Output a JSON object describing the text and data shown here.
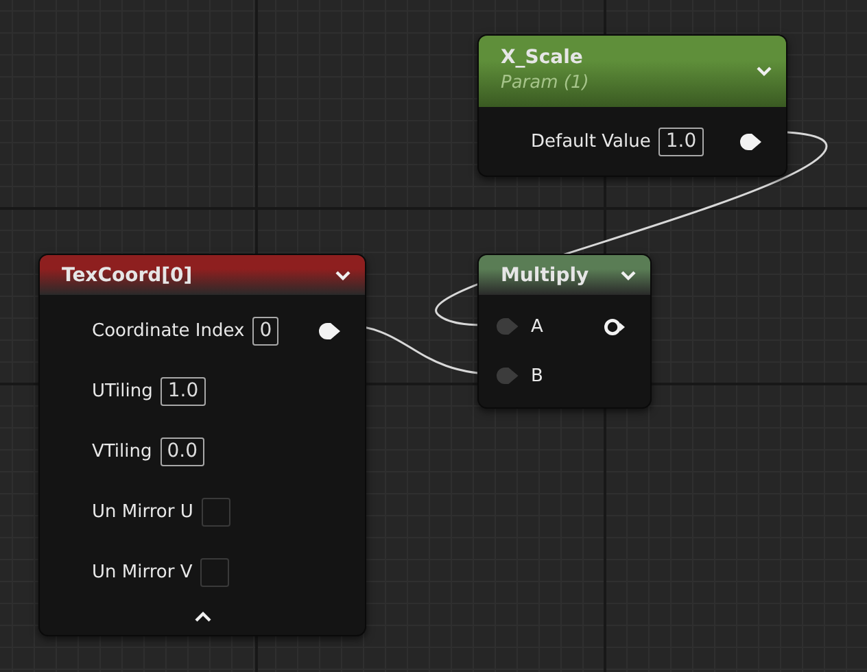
{
  "nodes": [
    {
      "title": "X_Scale",
      "subtitle": "Param (1)",
      "color": "#5f8f3a",
      "rows": [
        {
          "kind": "value",
          "label": "Default Value",
          "value": "1.0",
          "output": {
            "connected": true
          }
        }
      ]
    },
    {
      "title": "TexCoord[0]",
      "color": "#8e1f1f",
      "advanced_expanded": true,
      "rows": [
        {
          "kind": "value",
          "label": "Coordinate Index",
          "value": "0",
          "output": {
            "connected": true
          }
        },
        {
          "kind": "value",
          "label": "UTiling",
          "value": "1.0"
        },
        {
          "kind": "value",
          "label": "VTiling",
          "value": "0.0"
        },
        {
          "kind": "checkbox",
          "label": "Un Mirror U",
          "checked": false
        },
        {
          "kind": "checkbox",
          "label": "Un Mirror V",
          "checked": false
        }
      ]
    },
    {
      "title": "Multiply",
      "color": "#5a7d55",
      "rows": [
        {
          "kind": "input",
          "label": "A",
          "input": {
            "connected": true
          },
          "output": {
            "connected": false
          }
        },
        {
          "kind": "input",
          "label": "B",
          "input": {
            "connected": true
          }
        }
      ]
    }
  ]
}
